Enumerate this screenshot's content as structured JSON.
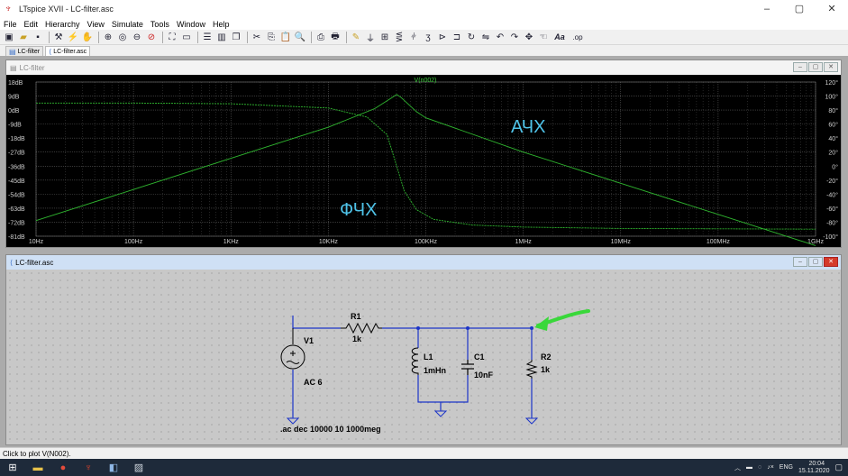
{
  "window": {
    "title": "LTspice XVII - LC-filter.asc",
    "controls": [
      "–",
      "▢",
      "✕"
    ]
  },
  "menu": [
    "File",
    "Edit",
    "Hierarchy",
    "View",
    "Simulate",
    "Tools",
    "Window",
    "Help"
  ],
  "toolbar": {
    "icons": [
      "new-schematic-icon",
      "open-icon",
      "save-icon",
      "control-panel-icon",
      "run-icon",
      "halt-icon",
      "zoom-in-icon",
      "zoom-pan-icon",
      "zoom-out-icon",
      "zoom-cancel-icon",
      "autoscale-icon",
      "zoom-full-icon",
      "tile-horizontal-icon",
      "tile-vertical-icon",
      "cascade-icon",
      "cut-icon",
      "copy-icon",
      "paste-icon",
      "find-icon",
      "print-icon",
      "print-setup-icon",
      "wire-icon",
      "ground-icon",
      "label-net-icon",
      "resistor-icon",
      "capacitor-icon",
      "inductor-icon",
      "diode-icon",
      "component-icon",
      "rotate-icon",
      "mirror-icon",
      "undo-icon",
      "redo-icon",
      "move-icon",
      "drag-icon",
      "text-icon",
      "spice-directive-icon"
    ],
    "text_button": "Aa",
    "op_button": ".op"
  },
  "tabs": [
    {
      "label": "LC-filter",
      "active": false
    },
    {
      "label": "LC-filter.asc",
      "active": true
    }
  ],
  "plot_window": {
    "title": "LC-filter",
    "trace_label": "V(n002)",
    "annotations": {
      "magnitude": "АЧХ",
      "phase": "ФЧХ"
    },
    "colors": {
      "background": "#000000",
      "grid": "#5a5a5a",
      "trace": "#2fb52f",
      "annotation": "#4fc3e8",
      "trace_label": "#3fcf3f"
    }
  },
  "chart_data": {
    "type": "line",
    "title": "V(n002)",
    "x_scale": "log",
    "x_ticks": [
      "10Hz",
      "100Hz",
      "1KHz",
      "10KHz",
      "100KHz",
      "1MHz",
      "10MHz",
      "100MHz",
      "1GHz"
    ],
    "y_left_ticks": [
      "18dB",
      "9dB",
      "0dB",
      "-9dB",
      "-18dB",
      "-27dB",
      "-36dB",
      "-45dB",
      "-54dB",
      "-63dB",
      "-72dB",
      "-81dB"
    ],
    "y_right_ticks": [
      "120°",
      "100°",
      "80°",
      "60°",
      "40°",
      "20°",
      "0°",
      "-20°",
      "-40°",
      "-60°",
      "-80°",
      "-100°"
    ],
    "ylim": [
      -81,
      18
    ],
    "y2lim": [
      -100,
      120
    ],
    "xlim_hz": [
      10,
      1000000000
    ],
    "grid": true,
    "series": [
      {
        "name": "АЧХ",
        "axis": "left",
        "points": [
          [
            10,
            -71
          ],
          [
            100,
            -51
          ],
          [
            1000,
            -31
          ],
          [
            10000,
            -11
          ],
          [
            30000,
            1
          ],
          [
            45000,
            8
          ],
          [
            50300,
            10
          ],
          [
            56000,
            8
          ],
          [
            80000,
            -1
          ],
          [
            100000,
            -5
          ],
          [
            1000000,
            -27
          ],
          [
            10000000,
            -47
          ],
          [
            100000000,
            -67
          ],
          [
            1000000000,
            -87
          ]
        ]
      },
      {
        "name": "ФЧХ",
        "axis": "right",
        "points": [
          [
            10,
            90
          ],
          [
            100,
            90
          ],
          [
            1000,
            89
          ],
          [
            10000,
            83
          ],
          [
            25000,
            70
          ],
          [
            40000,
            45
          ],
          [
            50300,
            0
          ],
          [
            60000,
            -35
          ],
          [
            80000,
            -62
          ],
          [
            120000,
            -76
          ],
          [
            300000,
            -84
          ],
          [
            1000000,
            -87
          ],
          [
            10000000,
            -89
          ],
          [
            1000000000,
            -90
          ]
        ]
      }
    ]
  },
  "schematic_window": {
    "title": "LC-filter.asc",
    "components": {
      "R1": {
        "name": "R1",
        "value": "1k"
      },
      "V1": {
        "name": "V1",
        "value": "AC 6"
      },
      "L1": {
        "name": "L1",
        "value": "1mHn"
      },
      "C1": {
        "name": "C1",
        "value": "10nF"
      },
      "R2": {
        "name": "R2",
        "value": "1k"
      }
    },
    "directive": ".ac dec 10000 10 1000meg",
    "colors": {
      "wire": "#1c34c8",
      "component": "#000000",
      "ground": "#1c34c8",
      "arrow": "#39d83a"
    }
  },
  "status_bar": "Click to plot V(N002).",
  "taskbar": {
    "icons": [
      "windows-start-icon",
      "file-explorer-icon",
      "chrome-icon",
      "ltspice-icon",
      "app-icon",
      "image-viewer-icon"
    ],
    "tray": {
      "lang": "ENG",
      "time": "20:04",
      "date": "15.11.2020"
    }
  }
}
